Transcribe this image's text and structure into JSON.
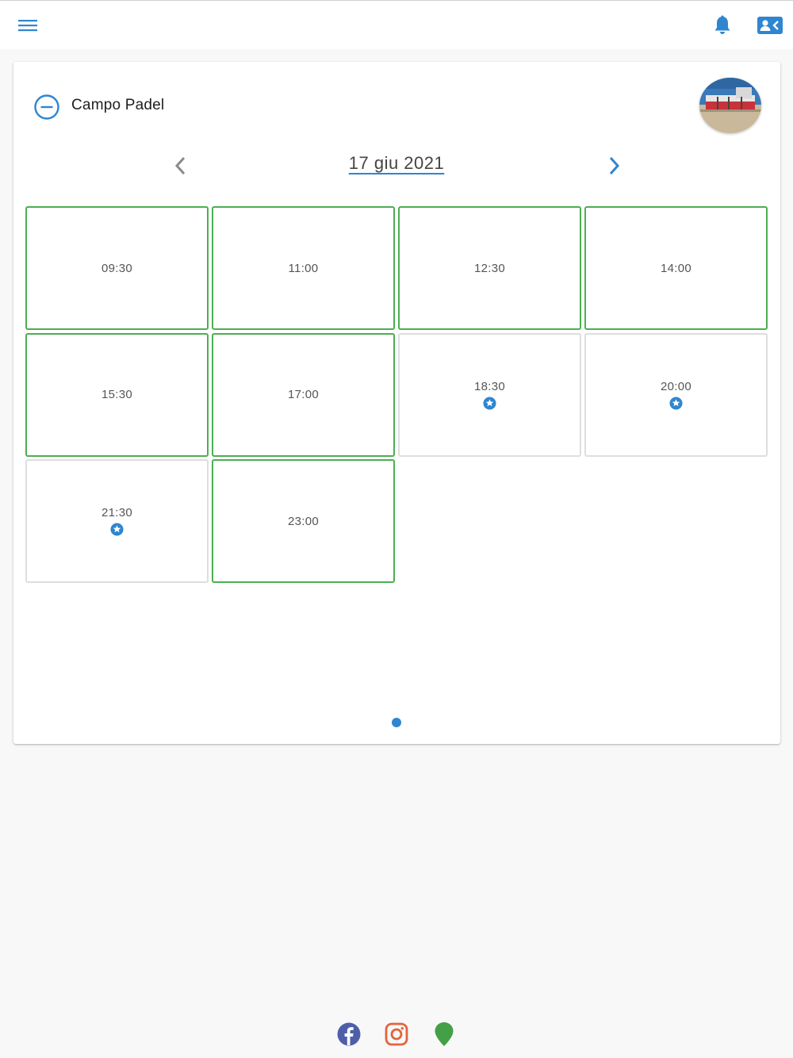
{
  "header": {
    "icons": {
      "menu": "menu-icon",
      "bell": "bell-icon",
      "contact": "contact-card-icon"
    },
    "accent_color": "#2e86d0"
  },
  "card": {
    "title": "Campo Padel",
    "collapse_icon": "minus-circle-icon",
    "thumbnail": "court-photo"
  },
  "date_nav": {
    "date": "17 giu 2021",
    "prev_icon": "chevron-left-icon",
    "next_icon": "chevron-right-icon"
  },
  "slots": [
    {
      "time": "09:30",
      "available": true,
      "starred": false
    },
    {
      "time": "11:00",
      "available": true,
      "starred": false
    },
    {
      "time": "12:30",
      "available": true,
      "starred": false
    },
    {
      "time": "14:00",
      "available": true,
      "starred": false
    },
    {
      "time": "15:30",
      "available": true,
      "starred": false
    },
    {
      "time": "17:00",
      "available": true,
      "starred": false
    },
    {
      "time": "18:30",
      "available": false,
      "starred": true
    },
    {
      "time": "20:00",
      "available": false,
      "starred": true
    },
    {
      "time": "21:30",
      "available": false,
      "starred": true
    },
    {
      "time": "23:00",
      "available": true,
      "starred": false
    }
  ],
  "colors": {
    "available_border": "#4caf50",
    "unavailable_border": "#dedede",
    "star": "#2e86d0"
  },
  "pagination": {
    "pages": 1,
    "current": 1
  },
  "footer": {
    "icons": [
      "facebook-icon",
      "instagram-icon",
      "map-pin-icon"
    ],
    "colors": {
      "facebook": "#4f5ea8",
      "instagram": "#e2643a",
      "map": "#43a047"
    }
  }
}
